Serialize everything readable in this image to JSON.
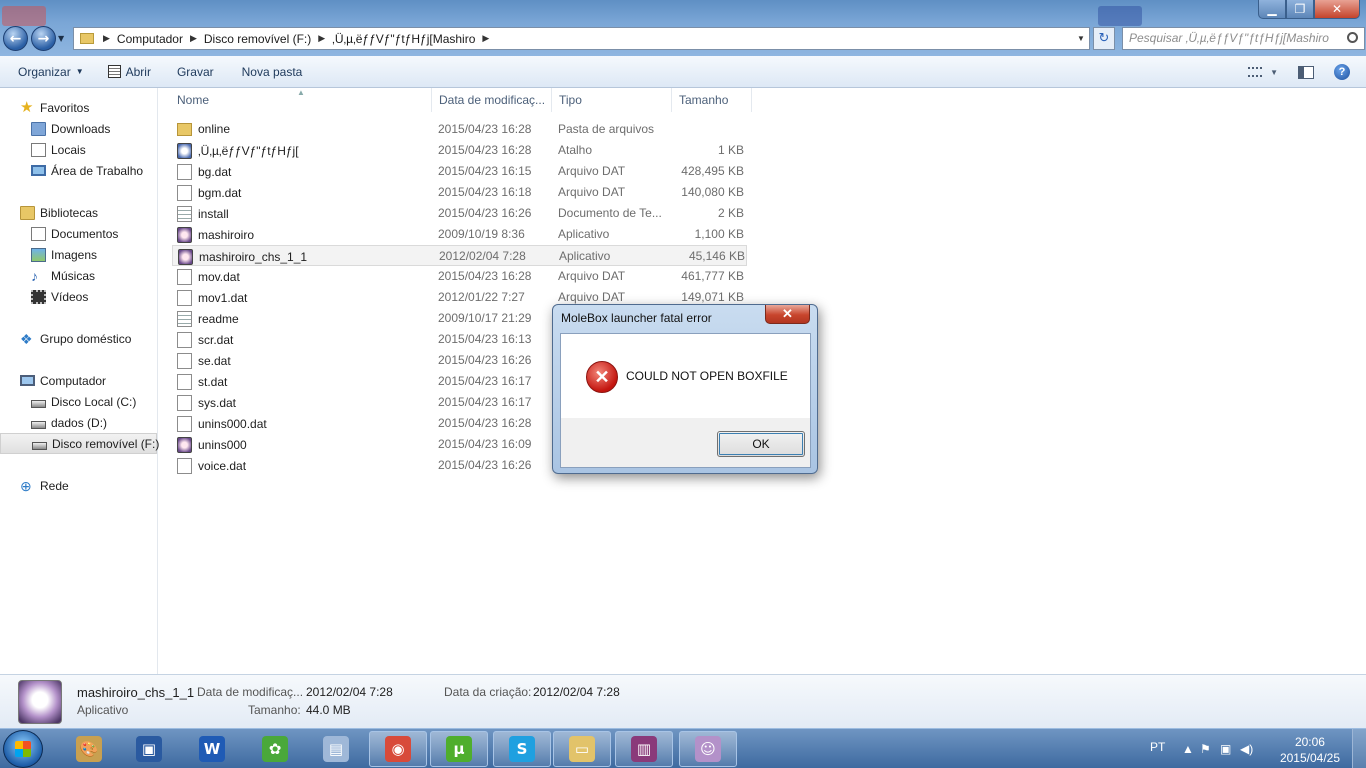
{
  "window": {
    "controls": {
      "minimize": "▁",
      "maximize": "❐",
      "close": "✕"
    }
  },
  "nav": {
    "back": "←",
    "forward": "→",
    "breadcrumb": [
      "Computador",
      "Disco removível (F:)",
      "‚Ü‚µ‚ëƒƒVƒ\"ƒtƒHƒj[Mashiro"
    ],
    "search_placeholder": "Pesquisar ‚Ü‚µ‚ëƒƒVƒ\"ƒtƒHƒj[Mashiro",
    "refresh": "↻"
  },
  "toolbar": {
    "organize": "Organizar",
    "open": "Abrir",
    "burn": "Gravar",
    "new_folder": "Nova pasta",
    "help": "?"
  },
  "sidebar": {
    "favorites": "Favoritos",
    "downloads": "Downloads",
    "locais": "Locais",
    "desktop": "Área de Trabalho",
    "libraries": "Bibliotecas",
    "documents": "Documentos",
    "images": "Imagens",
    "music": "Músicas",
    "videos": "Vídeos",
    "homegroup": "Grupo doméstico",
    "computer": "Computador",
    "disk_c": "Disco Local (C:)",
    "disk_d": "dados (D:)",
    "disk_f": "Disco removível (F:)",
    "network": "Rede"
  },
  "columns": {
    "name": "Nome",
    "date": "Data de modificaç...",
    "type": "Tipo",
    "size": "Tamanho"
  },
  "files": [
    {
      "name": "online",
      "date": "2015/04/23 16:28",
      "type": "Pasta de arquivos",
      "size": "",
      "icon": "folder-icon"
    },
    {
      "name": "‚Ü‚µ‚ëƒƒVƒ\"ƒtƒHƒj[",
      "date": "2015/04/23 16:28",
      "type": "Atalho",
      "size": "1 KB",
      "icon": "shortcut-icon"
    },
    {
      "name": "bg.dat",
      "date": "2015/04/23 16:15",
      "type": "Arquivo DAT",
      "size": "428,495 KB",
      "icon": "file-icon"
    },
    {
      "name": "bgm.dat",
      "date": "2015/04/23 16:18",
      "type": "Arquivo DAT",
      "size": "140,080 KB",
      "icon": "file-icon"
    },
    {
      "name": "install",
      "date": "2015/04/23 16:26",
      "type": "Documento de Te...",
      "size": "2 KB",
      "icon": "text-file-icon"
    },
    {
      "name": "mashiroiro",
      "date": "2009/10/19 8:36",
      "type": "Aplicativo",
      "size": "1,100 KB",
      "icon": "app-icon"
    },
    {
      "name": "mashiroiro_chs_1_1",
      "date": "2012/02/04 7:28",
      "type": "Aplicativo",
      "size": "45,146 KB",
      "icon": "app-icon"
    },
    {
      "name": "mov.dat",
      "date": "2015/04/23 16:28",
      "type": "Arquivo DAT",
      "size": "461,777 KB",
      "icon": "file-icon"
    },
    {
      "name": "mov1.dat",
      "date": "2012/01/22 7:27",
      "type": "Arquivo DAT",
      "size": "149,071 KB",
      "icon": "file-icon"
    },
    {
      "name": "readme",
      "date": "2009/10/17 21:29",
      "type": "",
      "size": "",
      "icon": "text-file-icon"
    },
    {
      "name": "scr.dat",
      "date": "2015/04/23 16:13",
      "type": "",
      "size": "",
      "icon": "file-icon"
    },
    {
      "name": "se.dat",
      "date": "2015/04/23 16:26",
      "type": "",
      "size": "",
      "icon": "file-icon"
    },
    {
      "name": "st.dat",
      "date": "2015/04/23 16:17",
      "type": "",
      "size": "",
      "icon": "file-icon"
    },
    {
      "name": "sys.dat",
      "date": "2015/04/23 16:17",
      "type": "",
      "size": "",
      "icon": "file-icon"
    },
    {
      "name": "unins000.dat",
      "date": "2015/04/23 16:28",
      "type": "",
      "size": "",
      "icon": "file-icon"
    },
    {
      "name": "unins000",
      "date": "2015/04/23 16:09",
      "type": "",
      "size": "",
      "icon": "app-icon"
    },
    {
      "name": "voice.dat",
      "date": "2015/04/23 16:26",
      "type": "",
      "size": "",
      "icon": "file-icon"
    }
  ],
  "dialog": {
    "title": "MoleBox launcher fatal error",
    "message": "COULD NOT OPEN BOXFILE",
    "ok": "OK",
    "close": "✕",
    "error_glyph": "✕"
  },
  "details": {
    "name": "mashiroiro_chs_1_1",
    "type": "Aplicativo",
    "modified_label": "Data de modificaç...",
    "modified_value": "2012/02/04 7:28",
    "created_label": "Data da criação:",
    "created_value": "2012/02/04 7:28",
    "size_label": "Tamanho:",
    "size_value": "44.0 MB"
  },
  "taskbar": {
    "apps": [
      {
        "name": "paint-app",
        "glyph": "🎨",
        "color": "#c8a050"
      },
      {
        "name": "package-app",
        "glyph": "▣",
        "color": "#2a5aa0"
      },
      {
        "name": "word-app",
        "glyph": "W",
        "color": "#1f5bb5"
      },
      {
        "name": "parrot-app",
        "glyph": "✿",
        "color": "#4aa83a"
      },
      {
        "name": "notepad-app",
        "glyph": "▤",
        "color": "#9fb8d8"
      },
      {
        "name": "chrome-app",
        "glyph": "◉",
        "color": "#d84a3a"
      },
      {
        "name": "utorrent-app",
        "glyph": "µ",
        "color": "#4fae2d"
      },
      {
        "name": "skype-app",
        "glyph": "S",
        "color": "#1fa0e0"
      },
      {
        "name": "explorer-app",
        "glyph": "▭",
        "color": "#e2c36a"
      },
      {
        "name": "winrar-app",
        "glyph": "▥",
        "color": "#8a3a7a"
      },
      {
        "name": "molebox-app",
        "glyph": "☺",
        "color": "#b391c9"
      }
    ],
    "language": "PT",
    "time": "20:06",
    "date": "2015/04/25"
  }
}
